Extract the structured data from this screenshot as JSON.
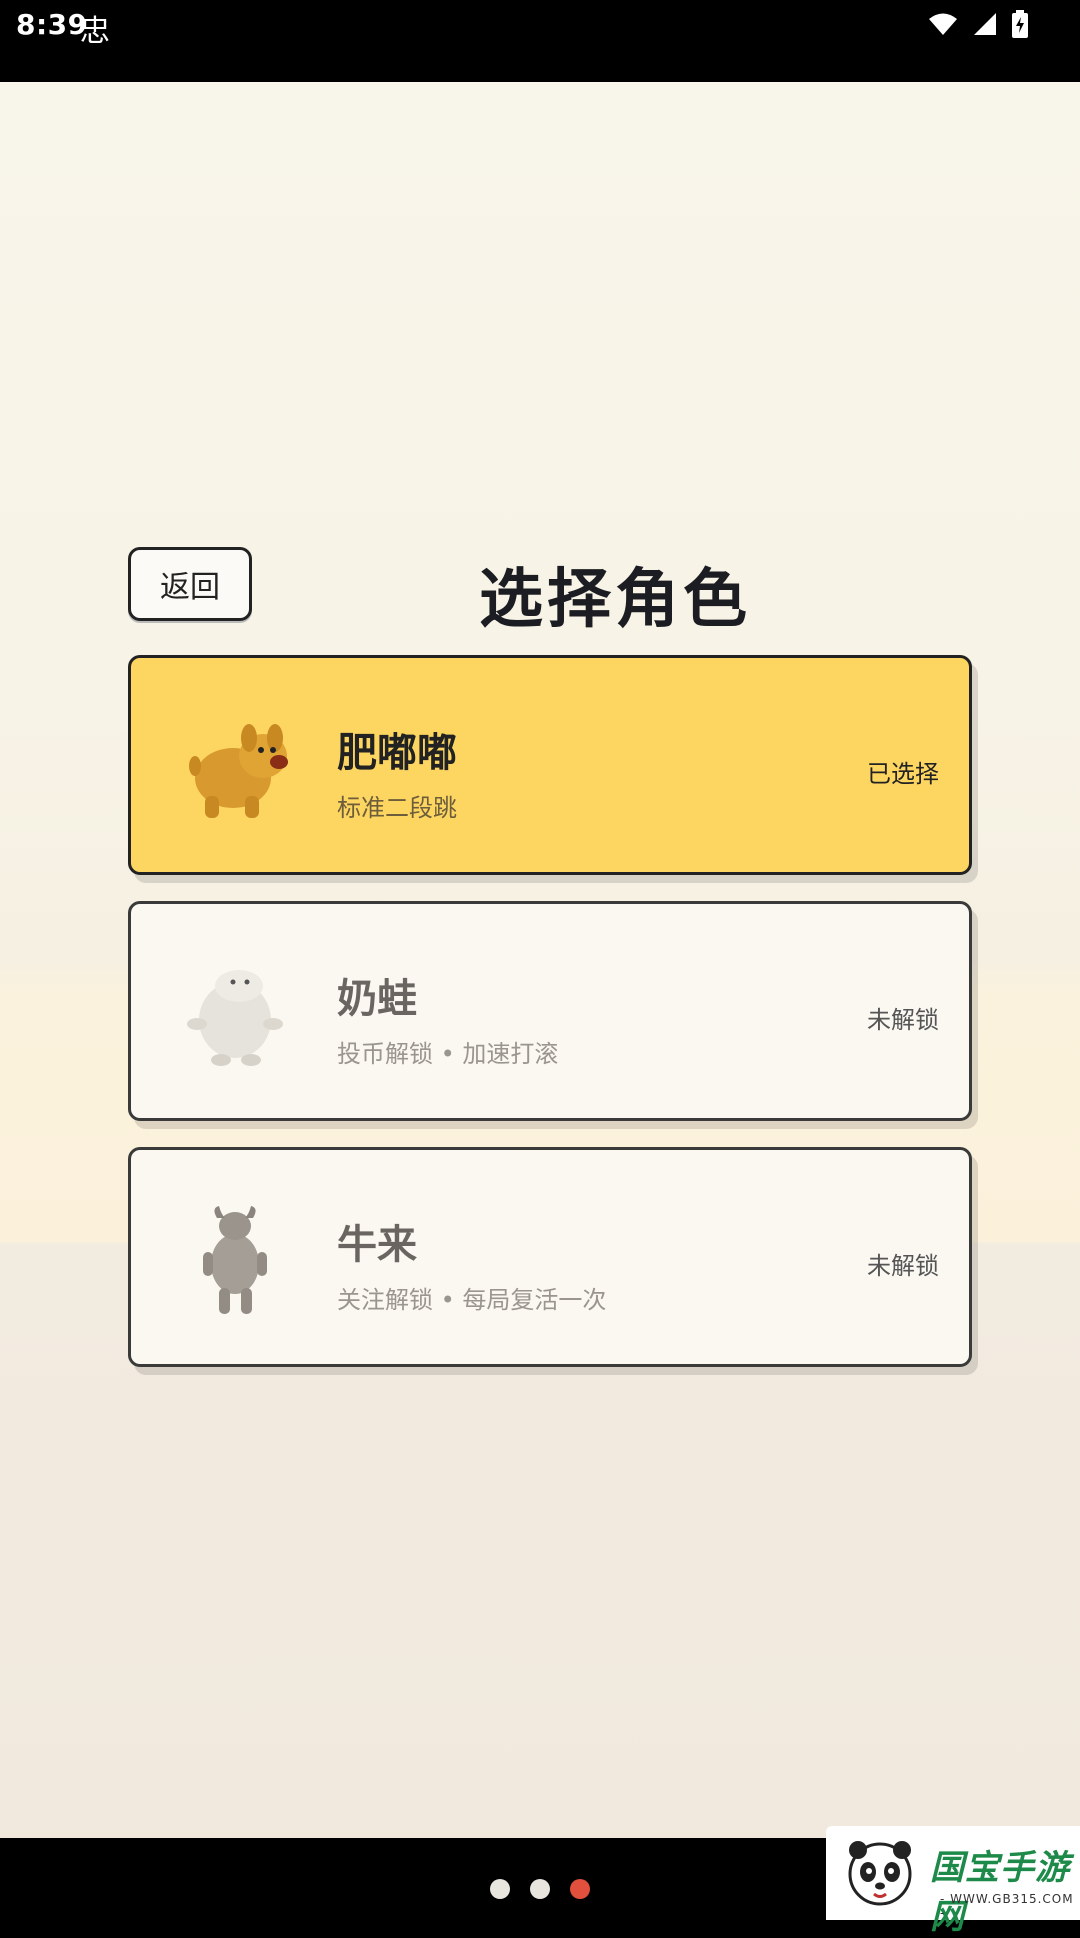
{
  "status_bar": {
    "time": "8:39",
    "bug_glyph": "忠",
    "icons": [
      "wifi-icon",
      "signal-icon",
      "battery-charging-icon"
    ]
  },
  "screen": {
    "back_label": "返回",
    "title": "选择角色"
  },
  "characters": [
    {
      "name": "肥嘟嘟",
      "desc": "标准二段跳",
      "status": "已选择",
      "selected": true,
      "avatar": "dog-icon"
    },
    {
      "name": "奶蛙",
      "desc": "投币解锁 • 加速打滚",
      "status": "未解锁",
      "selected": false,
      "avatar": "frog-icon"
    },
    {
      "name": "牛来",
      "desc": "关注解锁 • 每局复活一次",
      "status": "未解锁",
      "selected": false,
      "avatar": "bull-icon"
    }
  ],
  "page_indicator": {
    "count": 3,
    "active": 3
  },
  "watermark": {
    "title": "国宝手游网",
    "url": "- WWW.GB315.COM -"
  },
  "colors": {
    "selected_card": "#fdd662",
    "active_dot": "#e0503c",
    "watermark_green": "#1e8a4a"
  }
}
